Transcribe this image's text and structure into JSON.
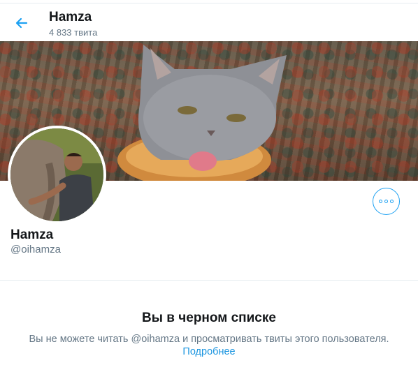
{
  "header": {
    "title": "Hamza",
    "tweet_count": "4 833 твита"
  },
  "profile": {
    "name": "Hamza",
    "handle": "@oihamza"
  },
  "blocked": {
    "title": "Вы в черном списке",
    "message": "Вы не можете читать @oihamza и просматривать твиты этого пользователя.",
    "learn_more": "Подробнее"
  },
  "colors": {
    "accent": "#1da1f2",
    "text_primary": "#14171a",
    "text_secondary": "#657786",
    "link": "#1b95e0",
    "divider": "#e6ecf0"
  },
  "icons": {
    "back": "arrow-left-icon",
    "more": "more-horizontal-icon"
  }
}
